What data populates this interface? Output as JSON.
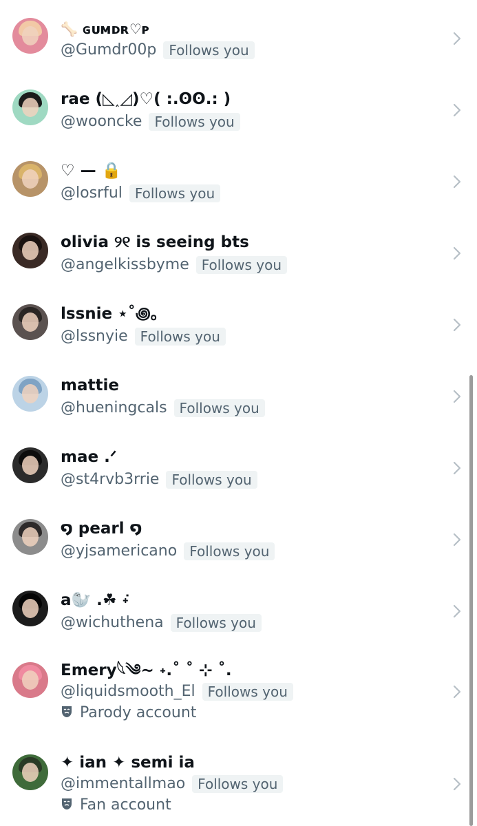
{
  "follows_you_label": "Follows you",
  "colors": {
    "handle": "#536471",
    "badge_bg": "#eff3f4",
    "name": "#0f1419",
    "chevron": "#b6bfc6"
  },
  "accounts": [
    {
      "display_name": "🦴 ɢᴜᴍᴅʀ♡ᴘ",
      "handle": "@Gumdr00p",
      "avatar": {
        "bg": "#e38b9c",
        "hair": "#f2c9a6",
        "icon": "avatar-photo"
      }
    },
    {
      "display_name": "rae (◺˰◿)♡( :.ʘʘ.: )",
      "handle": "@wooncke",
      "avatar": {
        "bg": "#9fd9c2",
        "hair": "#1b1b1b",
        "icon": "avatar-photo"
      }
    },
    {
      "display_name": "♡ — 🔒",
      "handle": "@losrful",
      "avatar": {
        "bg": "#b79368",
        "hair": "#d9b36a",
        "icon": "avatar-photo"
      }
    },
    {
      "display_name": "olivia ୨୧ is seeing bts",
      "handle": "@angelkissbyme",
      "avatar": {
        "bg": "#3a2a25",
        "hair": "#1a1210",
        "icon": "avatar-photo"
      }
    },
    {
      "display_name": "lssnie ⋆˚꩜｡",
      "handle": "@lssnyie",
      "avatar": {
        "bg": "#5b5250",
        "hair": "#2a2624",
        "icon": "avatar-photo"
      }
    },
    {
      "display_name": "mattie",
      "handle": "@hueningcals",
      "avatar": {
        "bg": "#bcd3e6",
        "hair": "#7fa3c4",
        "icon": "avatar-photo"
      }
    },
    {
      "display_name": "mae .ᐟ",
      "handle": "@st4rvb3rrie",
      "avatar": {
        "bg": "#2b2b2b",
        "hair": "#0d0d0d",
        "icon": "avatar-photo"
      }
    },
    {
      "display_name": "໑ pearl ໑",
      "handle": "@yjsamericano",
      "avatar": {
        "bg": "#8c8c8c",
        "hair": "#2d2a2a",
        "icon": "avatar-photo"
      }
    },
    {
      "display_name": "a🦭 .☘︎ ݁˖",
      "handle": "@wichuthena",
      "avatar": {
        "bg": "#1c1c1c",
        "hair": "#050505",
        "icon": "avatar-photo"
      }
    },
    {
      "display_name": "Emery𓆩༄~ ˖.˚ ˚ ⊹ ˚.",
      "handle": "@liquidsmooth_El",
      "label": "Parody account",
      "label_icon": "theater-mask-icon",
      "avatar": {
        "bg": "#d97a8a",
        "hair": "#f08aa0",
        "icon": "avatar-photo"
      }
    },
    {
      "display_name": "✦ ian ✦ semi ia",
      "handle": "@immentallmao",
      "label": "Fan account",
      "label_icon": "theater-mask-icon",
      "avatar": {
        "bg": "#3f6b3a",
        "hair": "#2a3a26",
        "icon": "avatar-photo"
      }
    }
  ]
}
